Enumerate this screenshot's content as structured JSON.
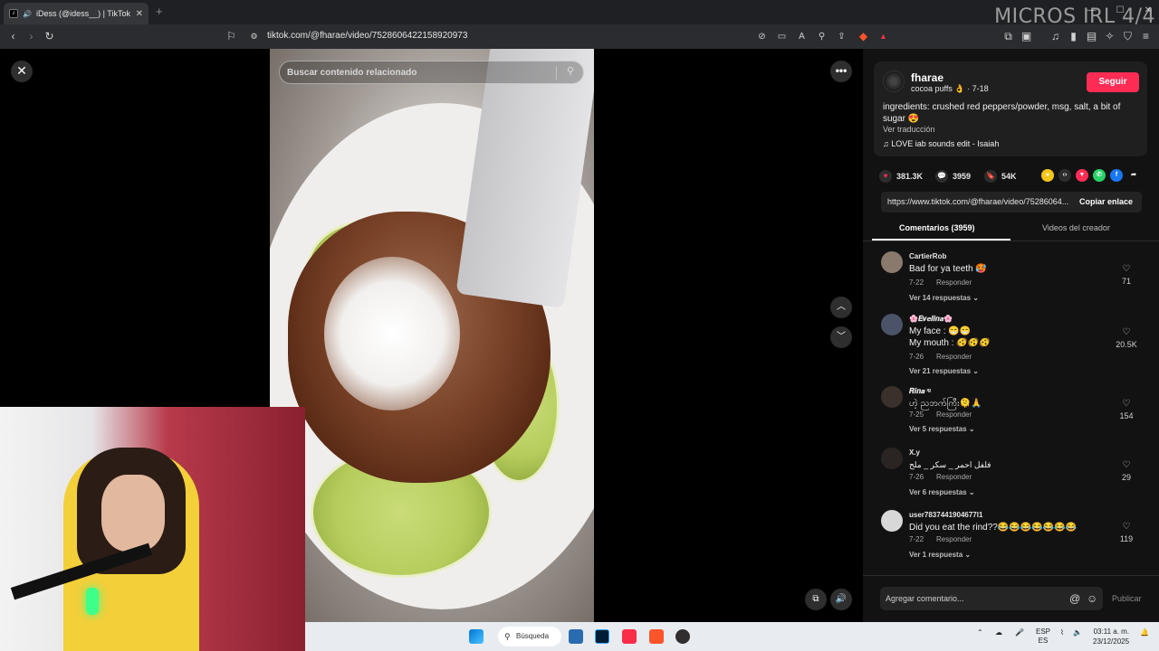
{
  "browser": {
    "tab_title": "iDess (@idess__) | TikTok",
    "tab_close": "✕",
    "new_tab": "+",
    "url": "tiktok.com/@fharae/video/7528606422158920973",
    "overlay_text": "MICROS IRL 4/4"
  },
  "player": {
    "search_placeholder": "Buscar contenido relacionado",
    "close_glyph": "✕",
    "more_glyph": "•••",
    "up_glyph": "︿",
    "down_glyph": "﹀"
  },
  "post": {
    "username": "fharae",
    "subline": "cocoa puffs 👌 · 7-18",
    "follow_label": "Seguir",
    "caption": "ingredients: crushed red peppers/powder, msg, salt, a bit of sugar 😍",
    "translate_label": "Ver traducción",
    "music": "♫  LOVE iab sounds edit - Isaiah",
    "likes": "381.3K",
    "comments_count": "3959",
    "saves": "54K",
    "link": "https://www.tiktok.com/@fharae/video/75286064...",
    "copy_label": "Copiar enlace",
    "tab_comments": "Comentarios (3959)",
    "tab_creator": "Videos del creador"
  },
  "comments": [
    {
      "user": "CartierRob",
      "text": "Bad for ya teeth 🥵",
      "date": "7-22",
      "reply": "Responder",
      "replies": "Ver 14 respuestas ⌄",
      "likes": "71"
    },
    {
      "user": "🌸𝑬𝒗𝒆𝒍𝒊𝒏𝒂🌸",
      "text": "My face : 😁😁\nMy mouth : 🫨🫨🫨",
      "date": "7-26",
      "reply": "Responder",
      "replies": "Ver 21 respuestas ⌄",
      "likes": "20.5K"
    },
    {
      "user": "𝑹𝒊𝒏𝒂 ᶦᵍ",
      "text": "ဟဲ့ ညဘက်ကြီး🫠🙏",
      "date": "7-25",
      "reply": "Responder",
      "replies": "Ver 5 respuestas ⌄",
      "likes": "154"
    },
    {
      "user": "X.y",
      "text": "فلفل احمر _ سكر _ ملح",
      "date": "7-26",
      "reply": "Responder",
      "replies": "Ver 6 respuestas ⌄",
      "likes": "29"
    },
    {
      "user": "user7837441904677l1",
      "text": "Did you eat the rind??😂😂😂😂😂😂😂",
      "date": "7-22",
      "reply": "Responder",
      "replies": "Ver 1 respuesta ⌄",
      "likes": "119"
    }
  ],
  "comment_bar": {
    "placeholder": "Agregar comentario...",
    "publish_label": "Publicar"
  },
  "taskbar": {
    "search_label": "Búsqueda",
    "lang_top": "ESP",
    "lang_bottom": "ES",
    "time": "03:11 a. m.",
    "date": "23/12/2025"
  }
}
